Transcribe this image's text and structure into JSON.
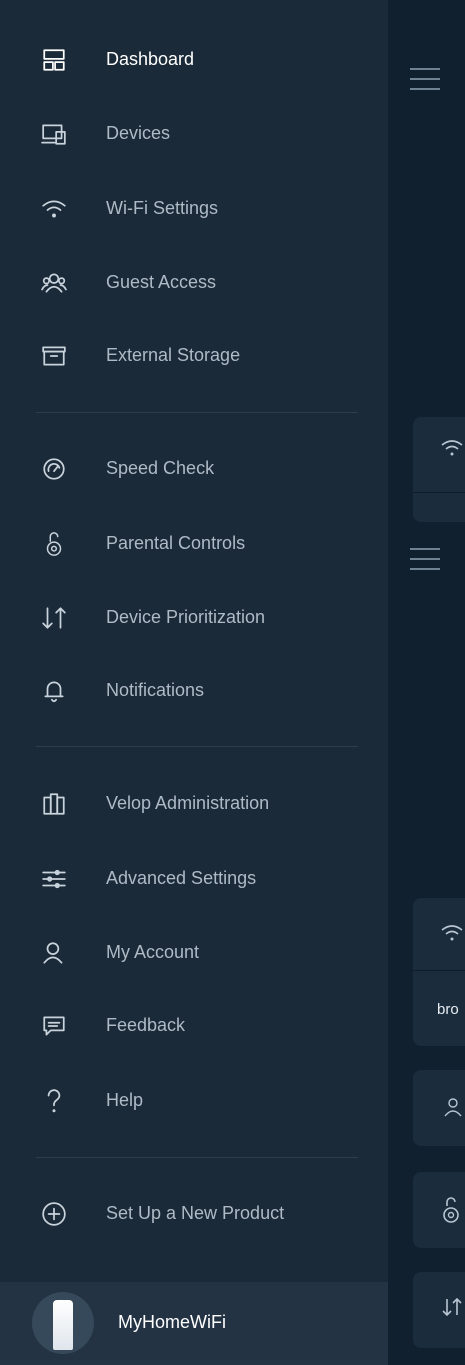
{
  "menu": {
    "items": [
      {
        "id": "dashboard",
        "label": "Dashboard",
        "icon": "dashboard-icon",
        "active": true
      },
      {
        "id": "devices",
        "label": "Devices",
        "icon": "devices-icon"
      },
      {
        "id": "wifi",
        "label": "Wi-Fi Settings",
        "icon": "wifi-icon"
      },
      {
        "id": "guest",
        "label": "Guest Access",
        "icon": "guest-access-icon"
      },
      {
        "id": "storage",
        "label": "External Storage",
        "icon": "storage-icon"
      },
      {
        "id": "speed",
        "label": "Speed Check",
        "icon": "speedometer-icon"
      },
      {
        "id": "parental",
        "label": "Parental Controls",
        "icon": "lock-icon"
      },
      {
        "id": "priority",
        "label": "Device Prioritization",
        "icon": "arrows-updown-icon"
      },
      {
        "id": "notifications",
        "label": "Notifications",
        "icon": "bell-icon"
      },
      {
        "id": "velop",
        "label": "Velop Administration",
        "icon": "nodes-icon"
      },
      {
        "id": "advanced",
        "label": "Advanced Settings",
        "icon": "sliders-icon"
      },
      {
        "id": "account",
        "label": "My Account",
        "icon": "user-icon"
      },
      {
        "id": "feedback",
        "label": "Feedback",
        "icon": "chat-icon"
      },
      {
        "id": "help",
        "label": "Help",
        "icon": "help-icon"
      },
      {
        "id": "setup",
        "label": "Set Up a New Product",
        "icon": "plus-circle-icon"
      }
    ]
  },
  "footer": {
    "network_name": "MyHomeWiFi"
  },
  "background": {
    "card_text": "bro"
  },
  "colors": {
    "drawer_bg": "#1b2a38",
    "app_bg": "#10202f",
    "text_active": "#ffffff",
    "text": "#aebac6"
  }
}
